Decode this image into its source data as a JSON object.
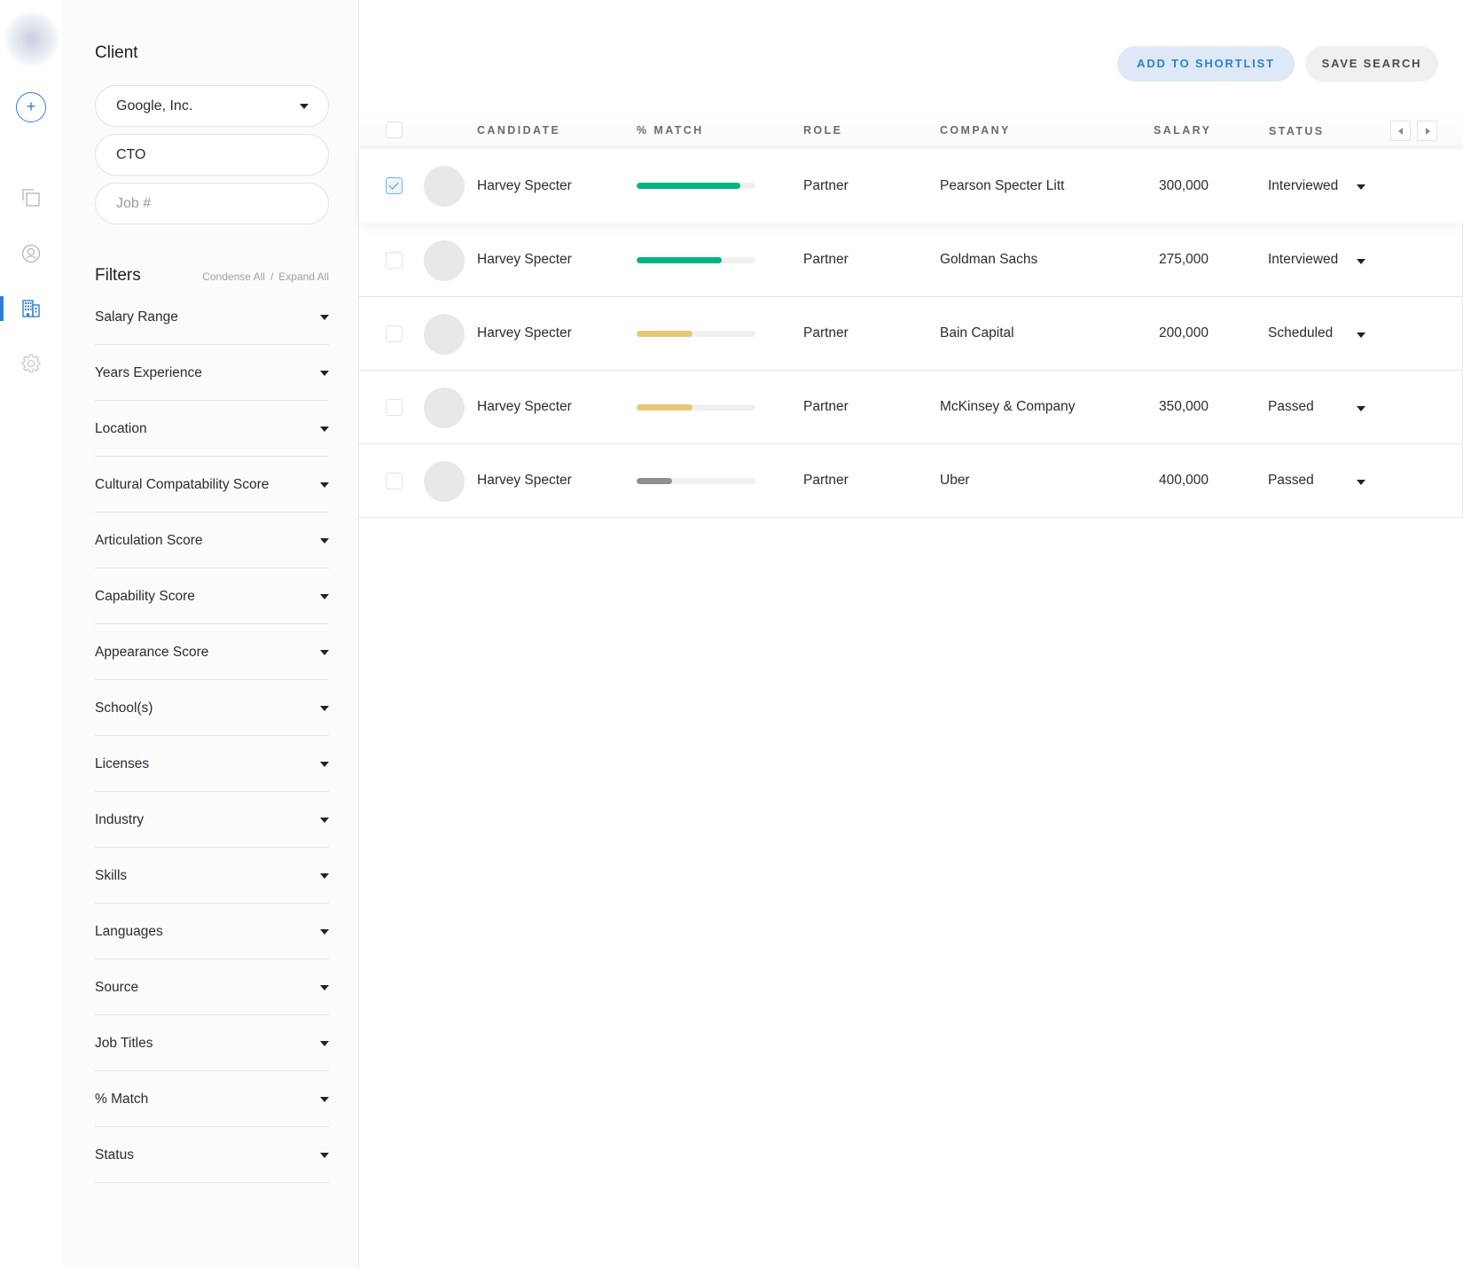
{
  "rail": {
    "logo_icon": "blurred-logo",
    "add_icon": "plus-circle-icon",
    "add_label": "+",
    "items": [
      {
        "icon": "copy-icon",
        "active": false
      },
      {
        "icon": "user-circle-icon",
        "active": false
      },
      {
        "icon": "building-icon",
        "active": true
      },
      {
        "icon": "gear-icon",
        "active": false
      }
    ],
    "accent_color": "#2d7fd3"
  },
  "sidebar": {
    "client_title": "Client",
    "client_select": {
      "value": "Google, Inc."
    },
    "role_input": {
      "value": "CTO"
    },
    "job_input": {
      "value": "",
      "placeholder": "Job #"
    },
    "filters_title": "Filters",
    "condense_all": "Condense All",
    "separator": "/",
    "expand_all": "Expand All",
    "filters": [
      {
        "label": "Salary Range"
      },
      {
        "label": "Years Experience"
      },
      {
        "label": "Location"
      },
      {
        "label": "Cultural Compatability Score"
      },
      {
        "label": "Articulation Score"
      },
      {
        "label": "Capability Score"
      },
      {
        "label": "Appearance Score"
      },
      {
        "label": "School(s)"
      },
      {
        "label": "Licenses"
      },
      {
        "label": "Industry"
      },
      {
        "label": "Skills"
      },
      {
        "label": "Languages"
      },
      {
        "label": "Source"
      },
      {
        "label": "Job Titles"
      },
      {
        "label": "% Match"
      },
      {
        "label": "Status"
      }
    ]
  },
  "toolbar": {
    "add_to_shortlist": "ADD TO SHORTLIST",
    "save_search": "SAVE SEARCH"
  },
  "table": {
    "columns": {
      "candidate": "CANDIDATE",
      "match": "% MATCH",
      "role": "ROLE",
      "company": "COMPANY",
      "salary": "SALARY",
      "status": "STATUS"
    },
    "match_colors": {
      "high": "#00b386",
      "medium": "#e8c878",
      "low": "#8e8e93"
    },
    "rows": [
      {
        "selected": true,
        "name": "Harvey Specter",
        "match": 87,
        "match_level": "high",
        "role": "Partner",
        "company": "Pearson Specter Litt",
        "salary": "300,000",
        "status": "Interviewed"
      },
      {
        "selected": false,
        "name": "Harvey Specter",
        "match": 72,
        "match_level": "high",
        "role": "Partner",
        "company": "Goldman Sachs",
        "salary": "275,000",
        "status": "Interviewed"
      },
      {
        "selected": false,
        "name": "Harvey Specter",
        "match": 47,
        "match_level": "medium",
        "role": "Partner",
        "company": "Bain Capital",
        "salary": "200,000",
        "status": "Scheduled"
      },
      {
        "selected": false,
        "name": "Harvey Specter",
        "match": 47,
        "match_level": "medium",
        "role": "Partner",
        "company": "McKinsey & Company",
        "salary": "350,000",
        "status": "Passed"
      },
      {
        "selected": false,
        "name": "Harvey Specter",
        "match": 30,
        "match_level": "low",
        "role": "Partner",
        "company": "Uber",
        "salary": "400,000",
        "status": "Passed"
      }
    ]
  }
}
